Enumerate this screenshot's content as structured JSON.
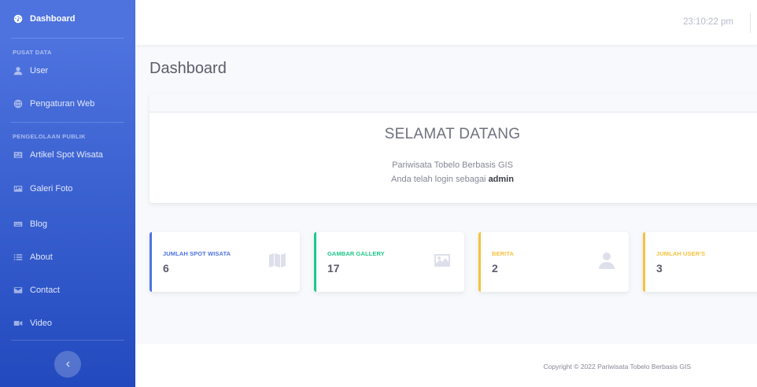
{
  "sidebar": {
    "dashboard": "Dashboard",
    "heading_pusat": "PUSAT DATA",
    "user": "User",
    "pengaturan": "Pengaturan Web",
    "heading_publik": "PENGELOLAAN PUBLIK",
    "artikel": "Artikel Spot Wisata",
    "galeri": "Galeri Foto",
    "blog": "Blog",
    "about": "About",
    "contact": "Contact",
    "video": "Video"
  },
  "topbar": {
    "clock": "23:10:22 pm"
  },
  "page": {
    "title": "Dashboard"
  },
  "welcome": {
    "title": "SELAMAT DATANG",
    "subtitle": "Pariwisata Tobelo Berbasis GIS",
    "login_prefix": "Anda telah login sebagai ",
    "login_user": "admin"
  },
  "stats": [
    {
      "label": "JUMLAH SPOT WISATA",
      "value": "6",
      "color": "#4e73df",
      "icon": "map-icon"
    },
    {
      "label": "GAMBAR GALLERY",
      "value": "17",
      "color": "#1cc88a",
      "icon": "image-icon"
    },
    {
      "label": "BERITA",
      "value": "2",
      "color": "#f6c23e",
      "icon": "user-icon"
    },
    {
      "label": "JUMLAH USER'S",
      "value": "3",
      "color": "#f6c23e",
      "icon": "users-icon"
    }
  ],
  "footer": {
    "copyright": "Copyright © 2022 Pariwisata Tobelo Berbasis GIS"
  }
}
